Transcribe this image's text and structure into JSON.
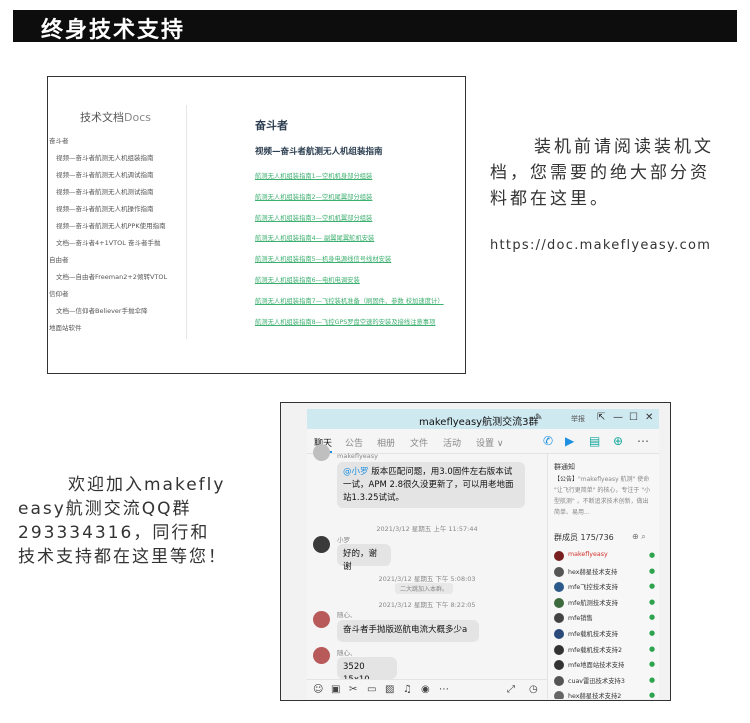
{
  "header": {
    "title": "终身技术支持"
  },
  "doc_site": {
    "sidebar_title": "技术文档",
    "sidebar_title_en": "Docs",
    "sidebar_items": [
      {
        "type": "cat",
        "label": "奋斗者"
      },
      {
        "type": "sub",
        "label": "视频—奋斗者航测无人机组装指南"
      },
      {
        "type": "sub",
        "label": "视频—奋斗者航测无人机调试指南"
      },
      {
        "type": "sub",
        "label": "视频—奋斗者航测无人机测试指南"
      },
      {
        "type": "sub",
        "label": "视频—奋斗者航测无人机操作指南"
      },
      {
        "type": "sub",
        "label": "视频—奋斗者航测无人机PPK使用指南"
      },
      {
        "type": "sub",
        "label": "文档—奋斗者4+1VTOL 奋斗者手抛"
      },
      {
        "type": "cat",
        "label": "自由者"
      },
      {
        "type": "sub",
        "label": "文档—自由者Freeman2+2倾转VTOL"
      },
      {
        "type": "cat",
        "label": "信仰者"
      },
      {
        "type": "sub",
        "label": "文档—信仰者Believer手抛伞降"
      },
      {
        "type": "cat",
        "label": "地面站软件"
      }
    ],
    "main_title": "奋斗者",
    "main_subtitle": "视频—奋斗者航测无人机组装指南",
    "links": [
      "航测无人机组装指南1—空机机身部分组装",
      "航测无人机组装指南2—空机尾翼部分组装",
      "航测无人机组装指南3—空机机翼部分组装",
      "航测无人机组装指南4— 副翼尾翼舵机安装",
      "航测无人机组装指南5—机身电源线信号线材安装",
      "航测无人机组装指南6—电机电调安装",
      "航测无人机组装指南7—飞控装机准备（刷固件、参数 校加速度计）",
      "航测无人机组装指南8—飞控GPS罗盘空速的安装及接线注意事项"
    ]
  },
  "right_note": "装机前请阅读装机文档，您需要的绝大部分资料都在这里。",
  "doc_url": "https://doc.makeflyeasy.com",
  "left_note": {
    "line1": "欢迎加入makefly",
    "line2": "easy航测交流QQ群",
    "line3": "293334316，同行和",
    "line4": "技术支持都在这里等您！"
  },
  "qq": {
    "group_title": "makeflyeasy航测交流3群",
    "report_label": "举报",
    "tabs": [
      "聊天",
      "公告",
      "相册",
      "文件",
      "活动",
      "设置 ∨"
    ],
    "messages": {
      "top_sender": "makeflyeasy",
      "top_mention": "@小罗",
      "top_text": " 版本匹配问题，用3.0固件左右版本试一试，APM 2.8很久没更新了，可以用老地面站1.3.25试试。",
      "ts1": "2021/3/12 星期五 上午 11:57:44",
      "sender2": "小罗",
      "msg2": "好的，谢谢",
      "ts2": "2021/3/12 星期五 下午 5:08:03",
      "sys": "二大跳加入本群。",
      "ts3": "2021/3/12 星期五 下午 8:22:05",
      "sender3": "随心、",
      "msg3": "奋斗者手抛版巡航电流大概多少a",
      "sender4": "随心、",
      "msg4": "3520 15x10"
    },
    "notice_title": "群通知",
    "notice_tag": "【公告】",
    "notice_text": "\"makeflyeasy 航测\" 使命 \"让飞行更简单\" 的核心，专注于 \"小型航测\" ，不断追求技术创新，做出简单、易用...",
    "members_header": "群成员 175/736",
    "members": [
      {
        "name": "makeflyeasy",
        "owner": true,
        "color": "#7a1f1f"
      },
      {
        "name": "hex赫星技术支持",
        "owner": false,
        "color": "#555"
      },
      {
        "name": "mfe飞控技术支持",
        "owner": false,
        "color": "#2b5a8a"
      },
      {
        "name": "mfe航测技术支持",
        "owner": false,
        "color": "#3d6b3d"
      },
      {
        "name": "mfe销售",
        "owner": false,
        "color": "#444"
      },
      {
        "name": "mfe载机技术支持",
        "owner": false,
        "color": "#2a4a7a"
      },
      {
        "name": "mfe载机技术支持2",
        "owner": false,
        "color": "#333"
      },
      {
        "name": "mfe地面站技术支持",
        "owner": false,
        "color": "#333"
      },
      {
        "name": "cuav雷迅技术支持3",
        "owner": false,
        "color": "#555"
      },
      {
        "name": "hex赫星技术支持2",
        "owner": false,
        "color": "#666"
      }
    ]
  }
}
